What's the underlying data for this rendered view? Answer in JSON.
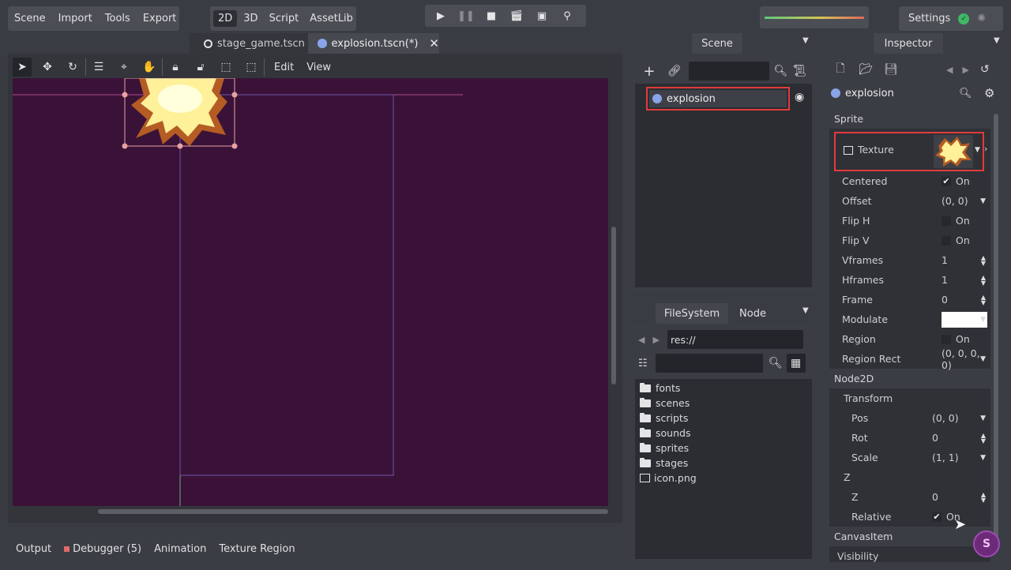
{
  "menus": {
    "main": [
      "Scene",
      "Import",
      "Tools",
      "Export"
    ],
    "modes": [
      "2D",
      "3D",
      "Script",
      "AssetLib"
    ],
    "active_mode": "2D",
    "settings_label": "Settings"
  },
  "scene_tabs": [
    {
      "label": "stage_game.tscn",
      "active": false
    },
    {
      "label": "explosion.tscn(*)",
      "active": true
    }
  ],
  "viewport_toolbar": {
    "edit_label": "Edit",
    "view_label": "View"
  },
  "viewport": {
    "background": "#3a1238"
  },
  "scene_panel": {
    "tab": "Scene",
    "root_node": "explosion"
  },
  "filesystem": {
    "tabs": [
      "FileSystem",
      "Node"
    ],
    "path": "res://",
    "items": [
      {
        "name": "fonts",
        "type": "folder"
      },
      {
        "name": "scenes",
        "type": "folder"
      },
      {
        "name": "scripts",
        "type": "folder"
      },
      {
        "name": "sounds",
        "type": "folder"
      },
      {
        "name": "sprites",
        "type": "folder"
      },
      {
        "name": "stages",
        "type": "folder"
      },
      {
        "name": "icon.png",
        "type": "image"
      }
    ]
  },
  "inspector": {
    "tab": "Inspector",
    "object_name": "explosion",
    "sections": {
      "sprite": "Sprite",
      "node2d": "Node2D",
      "transform": "Transform",
      "z": "Z",
      "canvasitem": "CanvasItem"
    },
    "props": {
      "texture": "Texture",
      "centered": {
        "label": "Centered",
        "value": "On"
      },
      "offset": {
        "label": "Offset",
        "value": "(0, 0)"
      },
      "flip_h": {
        "label": "Flip H",
        "value": "On"
      },
      "flip_v": {
        "label": "Flip V",
        "value": "On"
      },
      "vframes": {
        "label": "Vframes",
        "value": "1"
      },
      "hframes": {
        "label": "Hframes",
        "value": "1"
      },
      "frame": {
        "label": "Frame",
        "value": "0"
      },
      "modulate": {
        "label": "Modulate",
        "value": "#ffffff"
      },
      "region": {
        "label": "Region",
        "value": "On"
      },
      "region_rect": {
        "label": "Region Rect",
        "value": "(0, 0, 0, 0)"
      },
      "pos": {
        "label": "Pos",
        "value": "(0, 0)"
      },
      "rot": {
        "label": "Rot",
        "value": "0"
      },
      "scale": {
        "label": "Scale",
        "value": "(1, 1)"
      },
      "z": {
        "label": "Z",
        "value": "0"
      },
      "relative": {
        "label": "Relative",
        "value": "On"
      },
      "visibility": {
        "label": "Visibility"
      }
    }
  },
  "bottom_tabs": [
    "Output",
    "Debugger (5)",
    "Animation",
    "Texture Region"
  ],
  "colors": {
    "accent_red": "#e23b3b",
    "status_green": "#3fb866",
    "debugger_dot": "#e06a6a"
  }
}
